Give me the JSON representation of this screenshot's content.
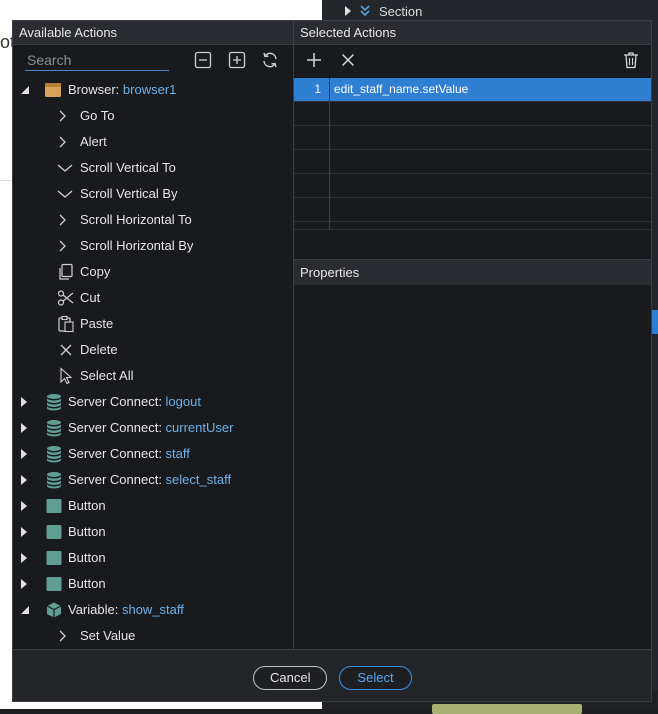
{
  "background": {
    "left_partial_text": "ot",
    "right_section_label": "Section"
  },
  "available": {
    "title": "Available Actions",
    "search_placeholder": "Search",
    "icons": [
      "collapse-all-icon",
      "expand-all-icon",
      "refresh-icon"
    ]
  },
  "tree": {
    "browser": {
      "label": "Browser: ",
      "value": "browser1"
    },
    "browser_children": [
      {
        "label": "Go To",
        "toggle": "right"
      },
      {
        "label": "Alert",
        "toggle": "right"
      },
      {
        "label": "Scroll Vertical To",
        "toggle": "down"
      },
      {
        "label": "Scroll Vertical By",
        "toggle": "down"
      },
      {
        "label": "Scroll Horizontal To",
        "toggle": "right"
      },
      {
        "label": "Scroll Horizontal By",
        "toggle": "right"
      },
      {
        "label": "Copy",
        "icon": "copy-icon"
      },
      {
        "label": "Cut",
        "icon": "scissors-icon"
      },
      {
        "label": "Paste",
        "icon": "paste-icon"
      },
      {
        "label": "Delete",
        "icon": "x-icon"
      },
      {
        "label": "Select All",
        "icon": "cursor-icon"
      }
    ],
    "server_connects": [
      {
        "label": "Server Connect: ",
        "value": "logout"
      },
      {
        "label": "Server Connect: ",
        "value": "currentUser"
      },
      {
        "label": "Server Connect: ",
        "value": "staff"
      },
      {
        "label": "Server Connect: ",
        "value": "select_staff"
      }
    ],
    "buttons": [
      "Button",
      "Button",
      "Button",
      "Button"
    ],
    "variable": {
      "label": "Variable: ",
      "value": "show_staff"
    },
    "variable_children": [
      {
        "label": "Set Value"
      }
    ]
  },
  "selected": {
    "title": "Selected Actions",
    "rows": [
      {
        "num": "1",
        "text": "edit_staff_name.setValue"
      }
    ],
    "empty_rows": 6
  },
  "properties": {
    "title": "Properties"
  },
  "footer": {
    "cancel_label": "Cancel",
    "select_label": "Select"
  },
  "colors": {
    "accent": "#2f7fd3",
    "value_text": "#6fb2e8",
    "browser_icon": "#d9a25a",
    "db_icon": "#5f9e91"
  }
}
